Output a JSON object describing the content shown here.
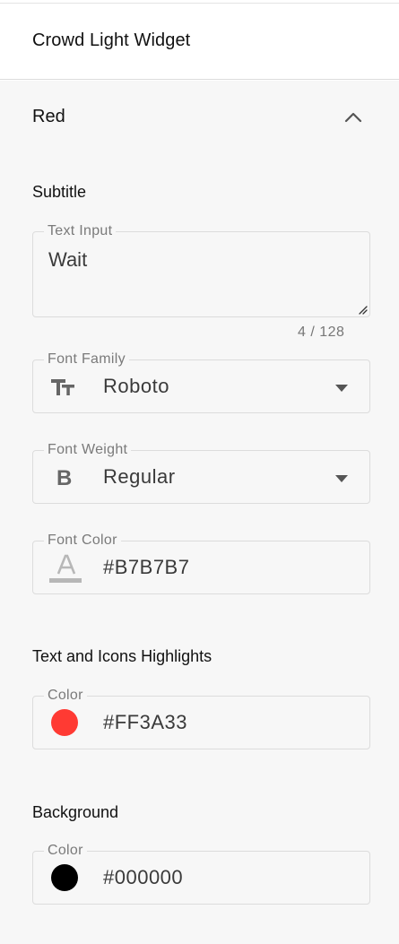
{
  "header": {
    "title": "Crowd Light Widget"
  },
  "section": {
    "title": "Red",
    "expanded": true
  },
  "subtitle": {
    "heading": "Subtitle",
    "text_input": {
      "label": "Text Input",
      "value": "Wait",
      "counter": "4 / 128"
    },
    "font_family": {
      "label": "Font Family",
      "value": "Roboto",
      "icon": "text-type-icon"
    },
    "font_weight": {
      "label": "Font Weight",
      "value": "Regular",
      "icon": "bold-icon"
    },
    "font_color": {
      "label": "Font Color",
      "value": "#B7B7B7",
      "icon": "font-color-icon",
      "color": "#B7B7B7"
    }
  },
  "highlights": {
    "heading": "Text and Icons Highlights",
    "color": {
      "label": "Color",
      "value": "#FF3A33",
      "color": "#FF3A33"
    }
  },
  "background": {
    "heading": "Background",
    "color": {
      "label": "Color",
      "value": "#000000",
      "color": "#000000"
    }
  }
}
